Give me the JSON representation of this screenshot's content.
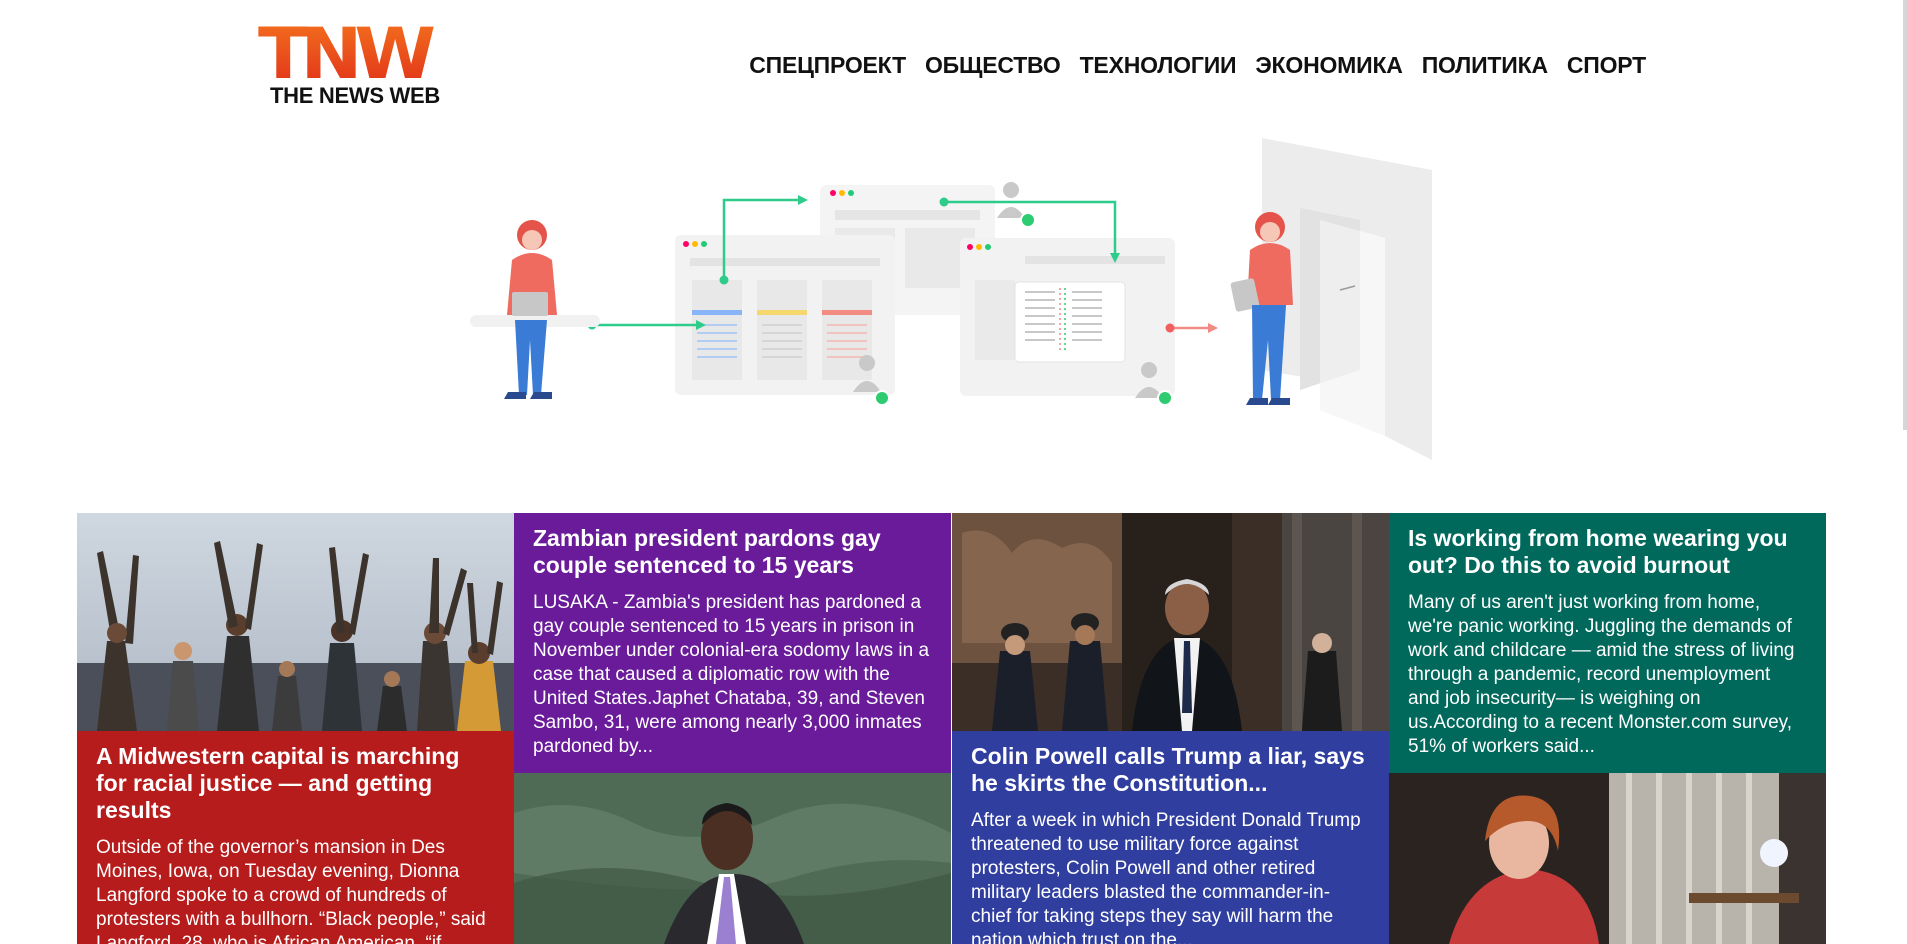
{
  "brand": {
    "logo_text": "TNW",
    "tagline": "THE NEWS WEB"
  },
  "nav": {
    "items": [
      "СПЕЦПРОЕКТ",
      "ОБЩЕСТВО",
      "ТЕХНОЛОГИИ",
      "ЭКОНОМИКА",
      "ПОЛИТИКА",
      "СПОРТ"
    ]
  },
  "articles": [
    {
      "title": "A Midwestern capital is marching for racial justice — and getting results",
      "excerpt": "Outside of the governor’s mansion in Des Moines, Iowa, on Tuesday evening, Dionna Langford spoke to a crowd of hundreds of protesters with a bullhorn. “Black people,” said Langford, 28, who is African American, “if you're a leader, we need to raise (a lot) of...",
      "color": "#b71c1c",
      "image": "protesters-photo"
    },
    {
      "title": "Zambian president pardons gay couple sentenced to 15 years",
      "excerpt": "LUSAKA - Zambia's president has pardoned a gay couple sentenced to 15 years in prison in November under colonial-era sodomy laws in a case that caused a diplomatic row with the United States.Japhet Chataba, 39, and Steven Sambo, 31, were among nearly 3,000 inmates pardoned by...",
      "color": "#6a1b9a",
      "image": "president-photo"
    },
    {
      "title": "Colin Powell calls Trump a liar, says he skirts the Constitution...",
      "excerpt": "After a week in which President Donald Trump threatened to use military force against protesters, Colin Powell and other retired military leaders blasted the commander-in-chief for taking steps they say will harm the nation which trust on the...",
      "color": "#303f9f",
      "image": "powell-photo"
    },
    {
      "title": "Is working from home wearing you out? Do this to avoid burnout",
      "excerpt": "Many of us aren't just working from home, we're panic working. Juggling the demands of work and childcare — amid the stress of living through a pandemic, record unemployment and job insecurity— is weighing on us.According to a recent Monster.com survey, 51% of workers said...",
      "color": "#00695c",
      "image": "home-worker-photo"
    }
  ]
}
